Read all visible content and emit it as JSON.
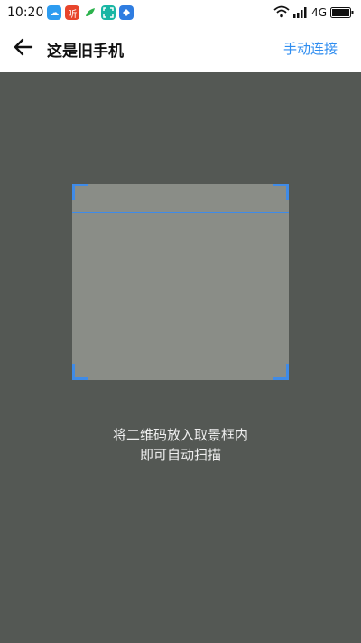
{
  "status_bar": {
    "time": "10:20",
    "notifications": [
      {
        "icon": "cloud-icon",
        "color": "#2d9cf0",
        "glyph": "☁"
      },
      {
        "icon": "listen-app-icon",
        "color": "#e8452c",
        "glyph": "听"
      },
      {
        "icon": "leaf-app-icon",
        "color": "#ffffff",
        "glyph": ""
      },
      {
        "icon": "scan-app-icon",
        "color": "#19b6a4",
        "glyph": ""
      },
      {
        "icon": "store-app-icon",
        "color": "#2f7de1",
        "glyph": ""
      }
    ],
    "network": "4G"
  },
  "app_bar": {
    "title": "这是旧手机",
    "action_label": "手动连接"
  },
  "scanner": {
    "hint_line1": "将二维码放入取景框内",
    "hint_line2": "即可自动扫描"
  },
  "colors": {
    "accent": "#2f8df0",
    "camera_bg": "#545854",
    "frame_bg": "#8a8d87"
  }
}
